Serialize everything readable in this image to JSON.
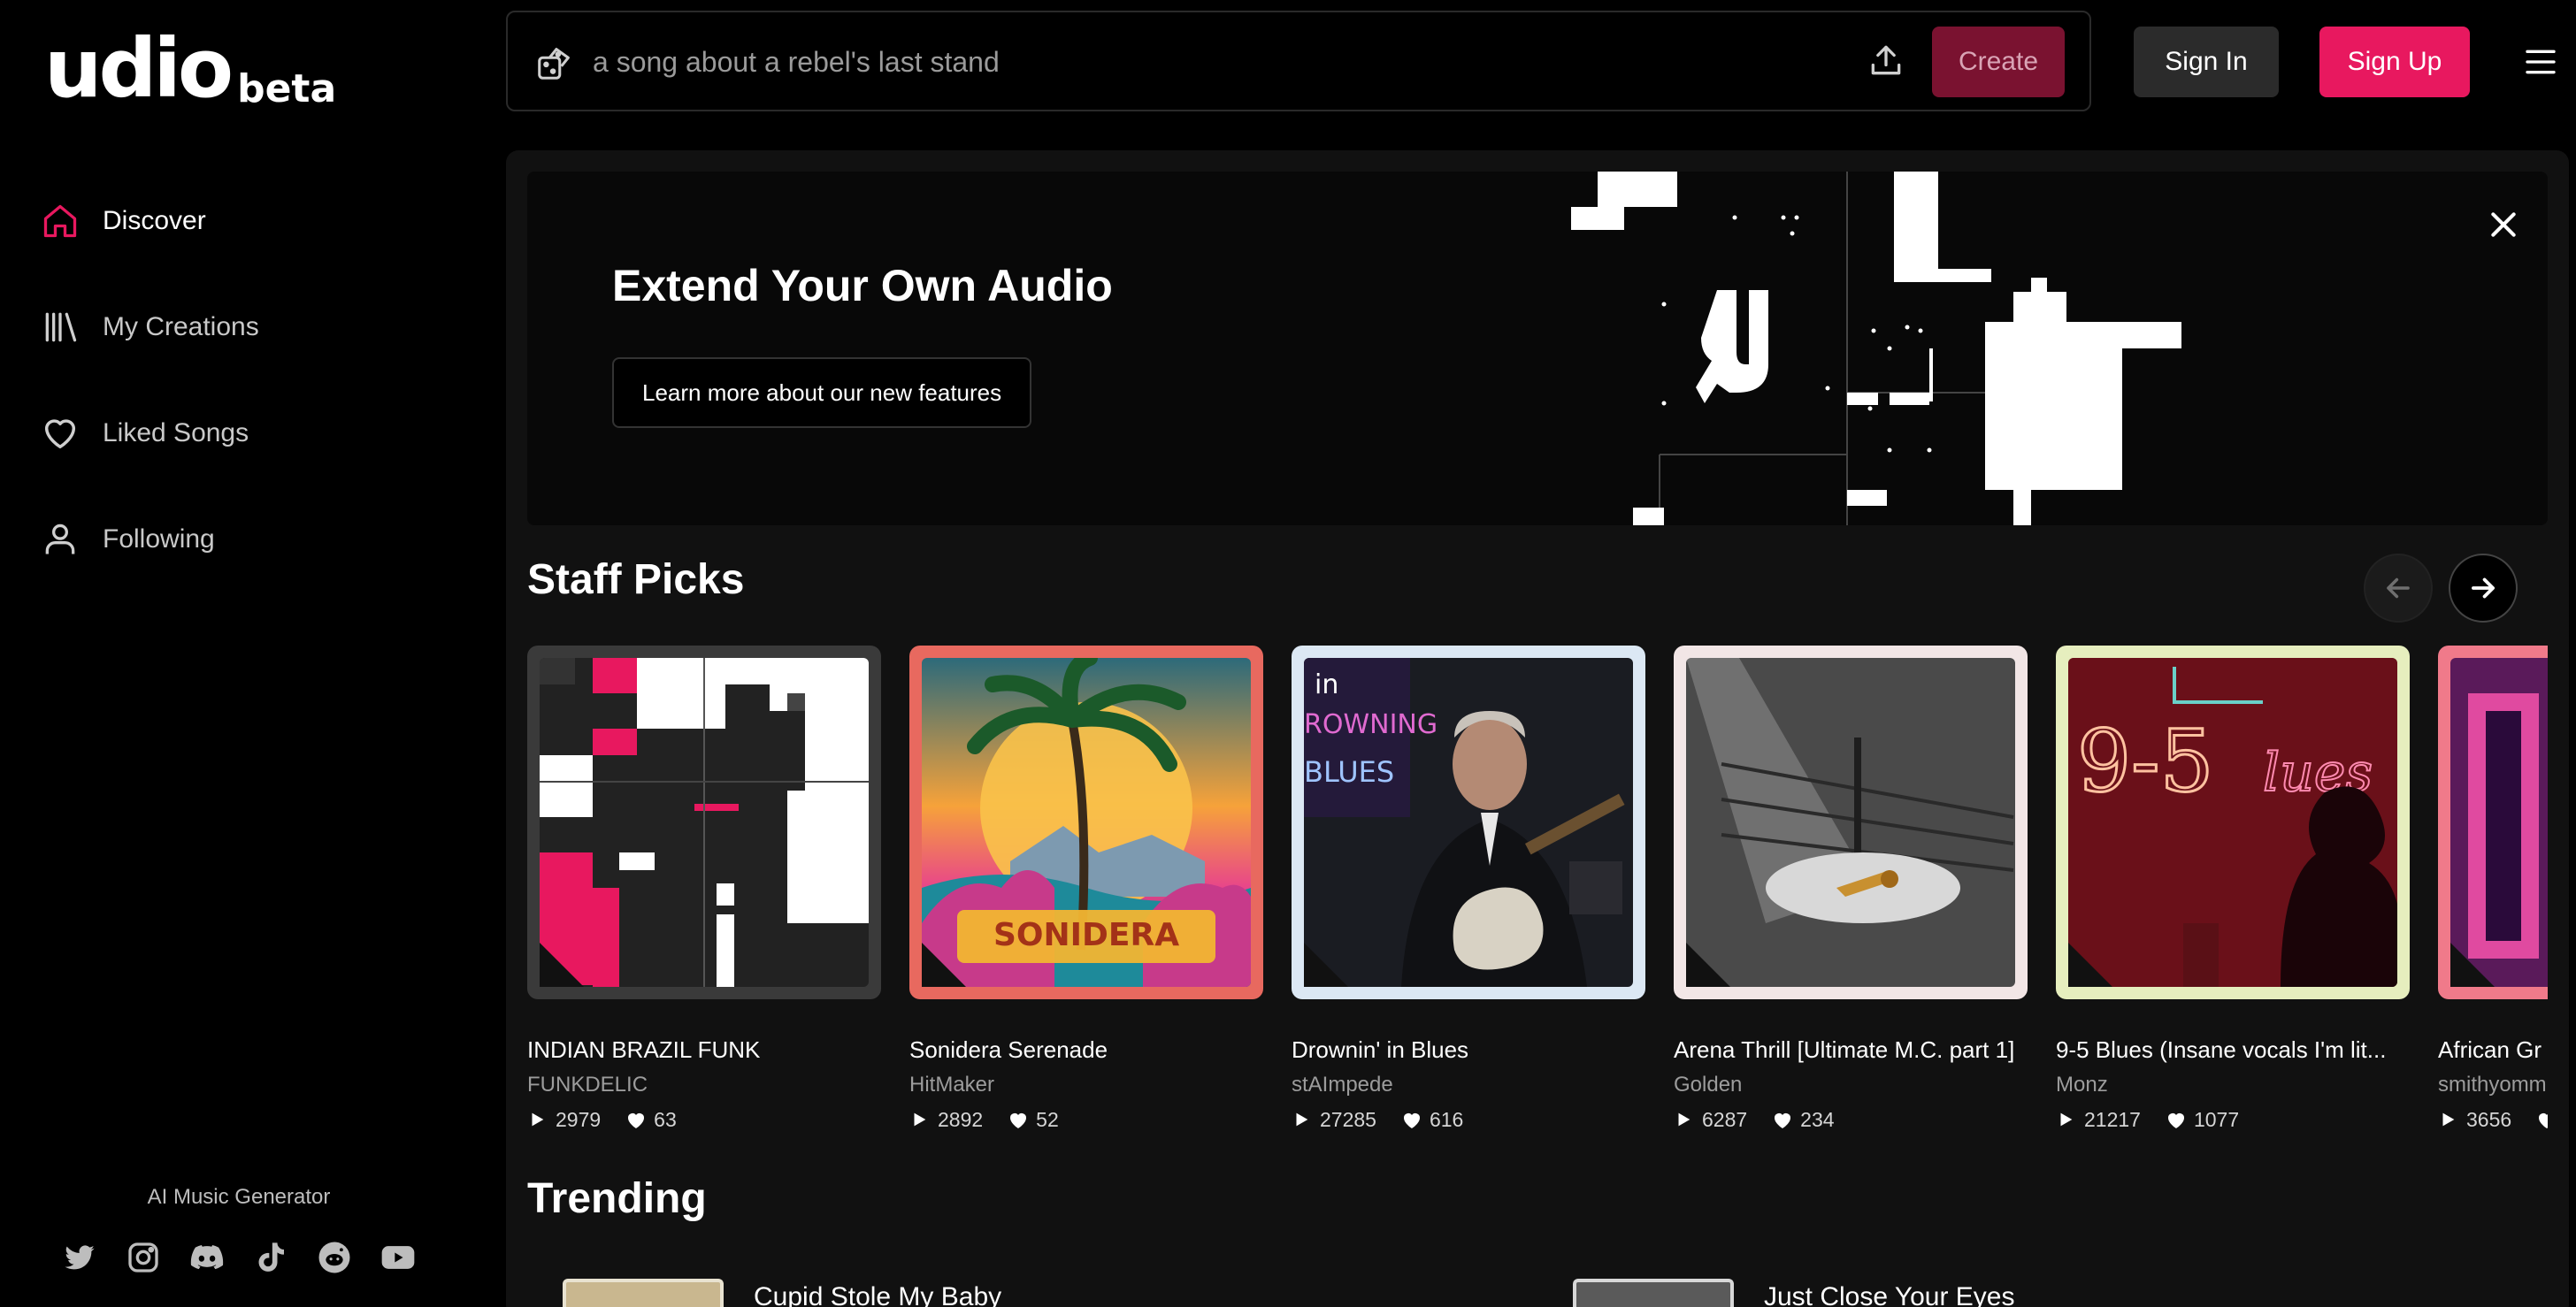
{
  "brand": {
    "logo": "udio",
    "badge": "beta"
  },
  "sidebar": {
    "items": [
      {
        "label": "Discover",
        "icon": "home-icon",
        "active": true
      },
      {
        "label": "My Creations",
        "icon": "library-icon",
        "active": false
      },
      {
        "label": "Liked Songs",
        "icon": "heart-icon",
        "active": false
      },
      {
        "label": "Following",
        "icon": "user-icon",
        "active": false
      }
    ],
    "footer_title": "AI Music Generator",
    "socials": [
      "twitter-icon",
      "instagram-icon",
      "discord-icon",
      "tiktok-icon",
      "reddit-icon",
      "youtube-icon"
    ]
  },
  "header": {
    "search_placeholder": "a song about a rebel's last stand",
    "create_label": "Create",
    "signin_label": "Sign In",
    "signup_label": "Sign Up"
  },
  "banner": {
    "title": "Extend Your Own Audio",
    "button_label": "Learn more about our new features"
  },
  "staff_picks": {
    "title": "Staff Picks",
    "cards": [
      {
        "title": "INDIAN BRAZIL FUNK",
        "artist": "FUNKDELIC",
        "plays": "2979",
        "likes": "63"
      },
      {
        "title": "Sonidera Serenade",
        "artist": "HitMaker",
        "plays": "2892",
        "likes": "52"
      },
      {
        "title": "Drownin' in Blues",
        "artist": "stAImpede",
        "plays": "27285",
        "likes": "616"
      },
      {
        "title": "Arena Thrill [Ultimate M.C. part 1]",
        "artist": "Golden",
        "plays": "6287",
        "likes": "234"
      },
      {
        "title": "9-5 Blues (Insane vocals I'm lit...",
        "artist": "Monz",
        "plays": "21217",
        "likes": "1077"
      },
      {
        "title": "African Gr",
        "artist": "smithyomm",
        "plays": "3656",
        "likes": ""
      }
    ]
  },
  "trending": {
    "title": "Trending",
    "items": [
      {
        "title": "Cupid Stole My Baby"
      },
      {
        "title": "Just Close Your Eyes"
      }
    ]
  },
  "colors": {
    "accent": "#e8185f",
    "create_bg": "#7a1230",
    "panel": "#111111"
  }
}
